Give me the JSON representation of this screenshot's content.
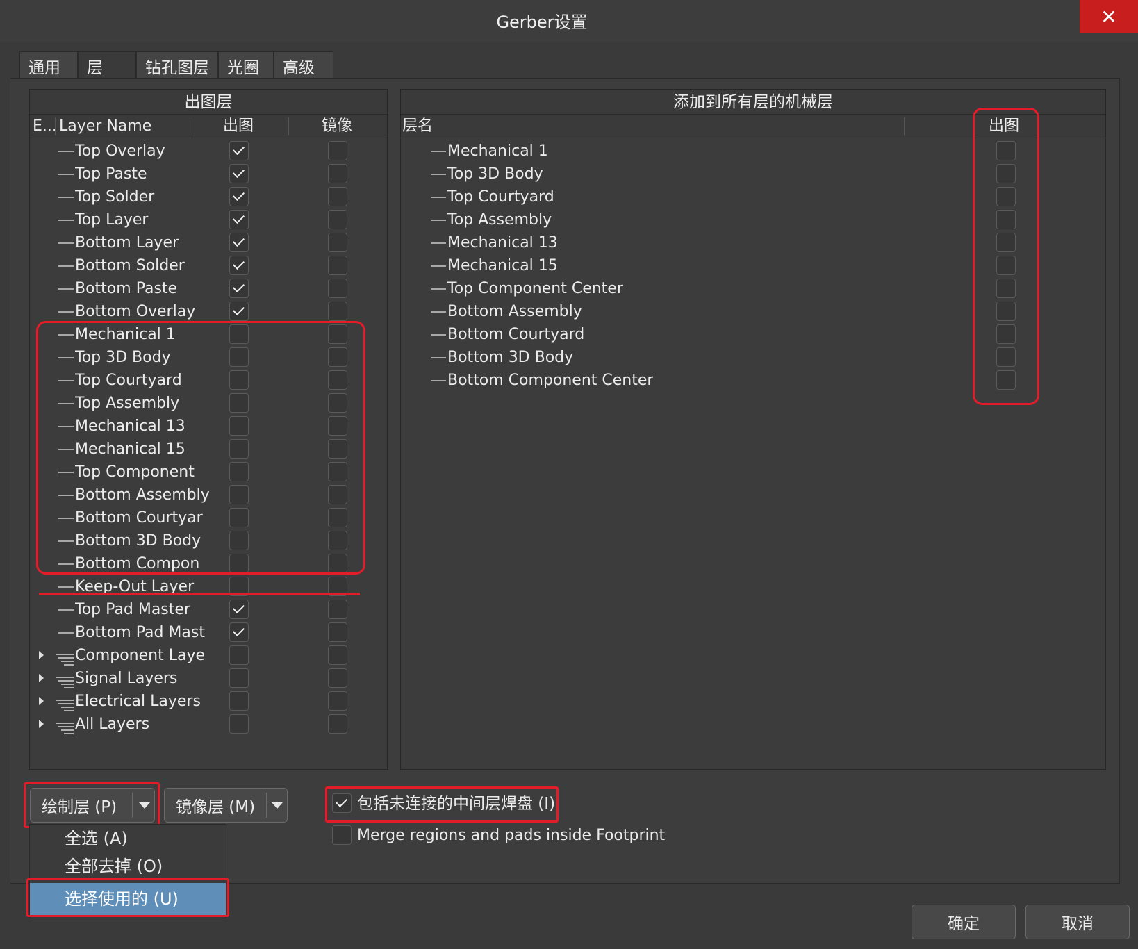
{
  "window": {
    "title": "Gerber设置",
    "close_icon": "close-icon"
  },
  "tabs": [
    {
      "label": "通用"
    },
    {
      "label": "层"
    },
    {
      "label": "钻孔图层"
    },
    {
      "label": "光圈"
    },
    {
      "label": "高级"
    }
  ],
  "left_panel": {
    "title": "出图层",
    "columns": {
      "expand": "E...",
      "name": "Layer Name",
      "plot": "出图",
      "mirror": "镜像"
    },
    "rows": [
      {
        "name": "Top Overlay",
        "plot": true,
        "mirror": false,
        "type": "layer"
      },
      {
        "name": "Top Paste",
        "plot": true,
        "mirror": false,
        "type": "layer"
      },
      {
        "name": "Top Solder",
        "plot": true,
        "mirror": false,
        "type": "layer"
      },
      {
        "name": "Top Layer",
        "plot": true,
        "mirror": false,
        "type": "layer"
      },
      {
        "name": "Bottom Layer",
        "plot": true,
        "mirror": false,
        "type": "layer"
      },
      {
        "name": "Bottom Solder",
        "plot": true,
        "mirror": false,
        "type": "layer"
      },
      {
        "name": "Bottom Paste",
        "plot": true,
        "mirror": false,
        "type": "layer"
      },
      {
        "name": "Bottom Overlay",
        "plot": true,
        "mirror": false,
        "type": "layer"
      },
      {
        "name": "Mechanical 1",
        "plot": false,
        "mirror": false,
        "type": "layer"
      },
      {
        "name": "Top 3D Body",
        "plot": false,
        "mirror": false,
        "type": "layer"
      },
      {
        "name": "Top Courtyard",
        "plot": false,
        "mirror": false,
        "type": "layer"
      },
      {
        "name": "Top Assembly",
        "plot": false,
        "mirror": false,
        "type": "layer"
      },
      {
        "name": "Mechanical 13",
        "plot": false,
        "mirror": false,
        "type": "layer"
      },
      {
        "name": "Mechanical 15",
        "plot": false,
        "mirror": false,
        "type": "layer"
      },
      {
        "name": "Top Component",
        "plot": false,
        "mirror": false,
        "type": "layer"
      },
      {
        "name": "Bottom Assembly",
        "plot": false,
        "mirror": false,
        "type": "layer"
      },
      {
        "name": "Bottom Courtyar",
        "plot": false,
        "mirror": false,
        "type": "layer"
      },
      {
        "name": "Bottom 3D Body",
        "plot": false,
        "mirror": false,
        "type": "layer"
      },
      {
        "name": "Bottom Compon",
        "plot": false,
        "mirror": false,
        "type": "layer"
      },
      {
        "name": "Keep-Out Layer",
        "plot": false,
        "mirror": false,
        "type": "layer"
      },
      {
        "name": "Top Pad Master",
        "plot": true,
        "mirror": false,
        "type": "layer"
      },
      {
        "name": "Bottom Pad Mast",
        "plot": true,
        "mirror": false,
        "type": "layer"
      },
      {
        "name": "Component Laye",
        "plot": false,
        "mirror": false,
        "type": "group"
      },
      {
        "name": "Signal Layers",
        "plot": false,
        "mirror": false,
        "type": "group"
      },
      {
        "name": "Electrical Layers",
        "plot": false,
        "mirror": false,
        "type": "group"
      },
      {
        "name": "All Layers",
        "plot": false,
        "mirror": false,
        "type": "group"
      }
    ]
  },
  "right_panel": {
    "title": "添加到所有层的机械层",
    "columns": {
      "name": "层名",
      "plot": "出图"
    },
    "rows": [
      {
        "name": "Mechanical 1",
        "plot": false
      },
      {
        "name": "Top 3D Body",
        "plot": false
      },
      {
        "name": "Top Courtyard",
        "plot": false
      },
      {
        "name": "Top Assembly",
        "plot": false
      },
      {
        "name": "Mechanical 13",
        "plot": false
      },
      {
        "name": "Mechanical 15",
        "plot": false
      },
      {
        "name": "Top Component Center",
        "plot": false
      },
      {
        "name": "Bottom Assembly",
        "plot": false
      },
      {
        "name": "Bottom Courtyard",
        "plot": false
      },
      {
        "name": "Bottom 3D Body",
        "plot": false
      },
      {
        "name": "Bottom Component Center",
        "plot": false
      }
    ]
  },
  "bottom": {
    "plot_layers_button": "绘制层 (P)",
    "mirror_layers_button": "镜像层 (M)",
    "plot_menu": [
      {
        "label": "全选 (A)",
        "selected": false
      },
      {
        "label": "全部去掉 (O)",
        "selected": false
      },
      {
        "label": "选择使用的 (U)",
        "selected": true
      }
    ],
    "include_unconnected": {
      "label": "包括未连接的中间层焊盘 (I)",
      "checked": true
    },
    "merge_regions": {
      "label": "Merge regions and pads inside Footprint",
      "checked": false
    }
  },
  "footer": {
    "ok": "确定",
    "cancel": "取消"
  },
  "colors": {
    "highlight": "#e41c2a",
    "selected_menu": "#5f8fb8",
    "close": "#c81e1e"
  }
}
